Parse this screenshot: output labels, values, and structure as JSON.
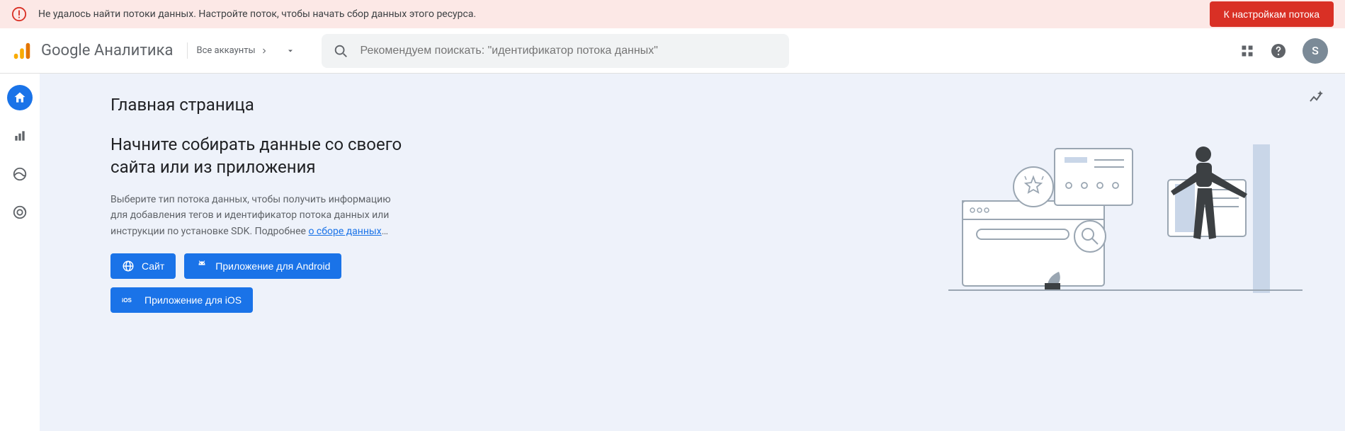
{
  "alert": {
    "text": "Не удалось найти потоки данных. Настройте поток, чтобы начать сбор данных этого ресурса.",
    "button": "К настройкам потока"
  },
  "header": {
    "product": "Google Аналитика",
    "accounts_label": "Все аккаунты",
    "search_placeholder": "Рекомендуем поискать: \"идентификатор потока данных\"",
    "avatar_initial": "S"
  },
  "main": {
    "page_title": "Главная страница",
    "heading": "Начните собирать данные со своего сайта или из приложения",
    "desc_part1": "Выберите тип потока данных, чтобы получить информацию для добавления тегов и идентификатор потока данных или инструкции по установке SDK. Подробнее ",
    "desc_link": "о сборе данных",
    "desc_ellipsis": "…",
    "buttons": {
      "web": "Сайт",
      "android": "Приложение для Android",
      "ios": "Приложение для iOS"
    }
  }
}
